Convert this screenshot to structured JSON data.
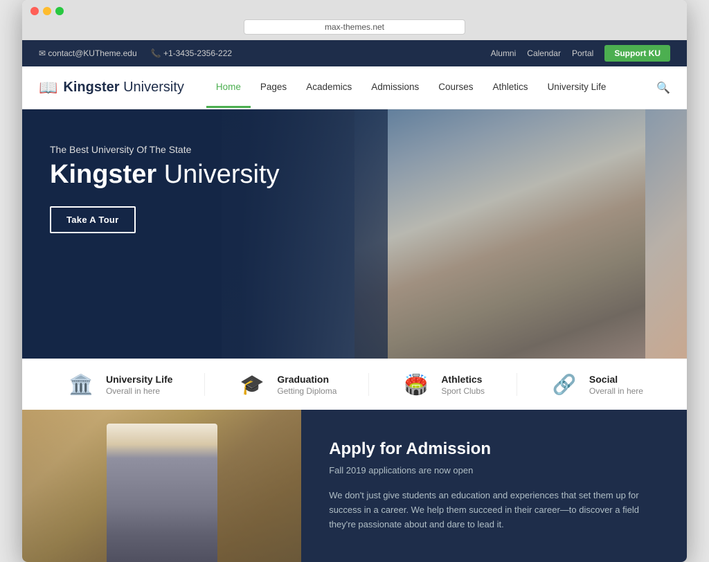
{
  "browser": {
    "url": "max-themes.net"
  },
  "utility_bar": {
    "email": "contact@KUTheme.edu",
    "phone": "+1-3435-2356-222",
    "links": [
      "Alumni",
      "Calendar",
      "Portal"
    ],
    "support_btn": "Support KU"
  },
  "logo": {
    "name": "Kingster University",
    "strong": "Kingster",
    "light": " University",
    "icon": "📖"
  },
  "nav": {
    "items": [
      {
        "label": "Home",
        "active": true
      },
      {
        "label": "Pages",
        "active": false
      },
      {
        "label": "Academics",
        "active": false
      },
      {
        "label": "Admissions",
        "active": false
      },
      {
        "label": "Courses",
        "active": false
      },
      {
        "label": "Athletics",
        "active": false
      },
      {
        "label": "University Life",
        "active": false
      }
    ]
  },
  "hero": {
    "subtitle": "The Best University Of The State",
    "title_strong": "Kingster",
    "title_light": " University",
    "cta_label": "Take A Tour"
  },
  "quick_links": [
    {
      "icon": "🏛️",
      "title": "University Life",
      "subtitle": "Overall in here"
    },
    {
      "icon": "🎓",
      "title": "Graduation",
      "subtitle": "Getting Diploma"
    },
    {
      "icon": "🏟️",
      "title": "Athletics",
      "subtitle": "Sport Clubs"
    },
    {
      "icon": "🔗",
      "title": "Social",
      "subtitle": "Overall in here"
    }
  ],
  "admission": {
    "title": "Apply for Admission",
    "subtitle": "Fall 2019 applications are now open",
    "body": "We don't just give students an education and experiences that set them up for success in a career. We help them succeed in their career—to discover a field they're passionate about and dare to lead it."
  }
}
